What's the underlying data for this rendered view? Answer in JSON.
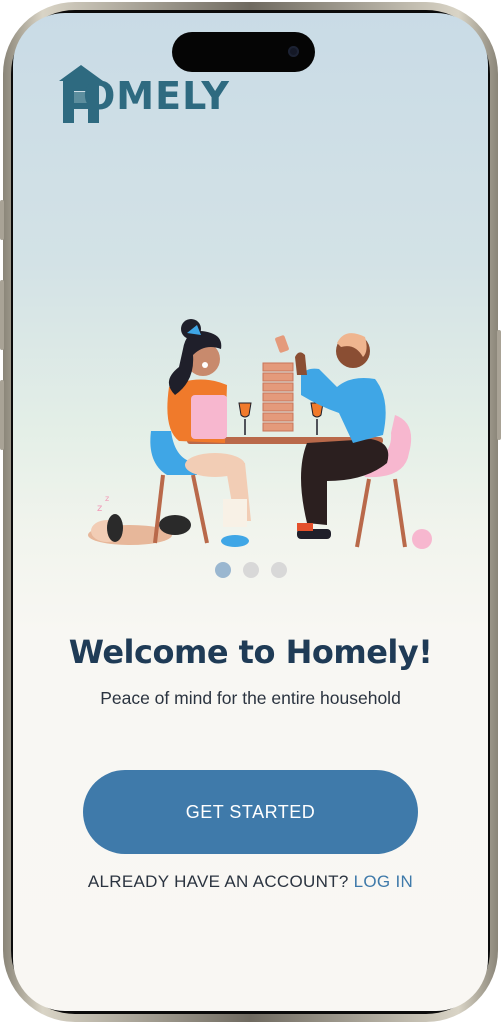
{
  "app": {
    "brand_name": "OMELY",
    "brand_full": "Homely"
  },
  "carousel": {
    "pages": 3,
    "active_index": 0
  },
  "welcome": {
    "title": "Welcome to Homely!",
    "subtitle": "Peace of mind for the entire household"
  },
  "actions": {
    "get_started_label": "GET STARTED",
    "have_account_text": "ALREADY HAVE AN ACCOUNT?",
    "login_label": "LOG IN"
  },
  "colors": {
    "brand_teal": "#2e6a80",
    "primary_button": "#3f7aaa",
    "title_text": "#1f3b56",
    "dot_active": "#9ab7d0",
    "dot_inactive": "#d8d8d8"
  },
  "icons": {
    "logo": "house-h-logo-icon",
    "illustration": "couple-playing-jenga-illustration"
  }
}
